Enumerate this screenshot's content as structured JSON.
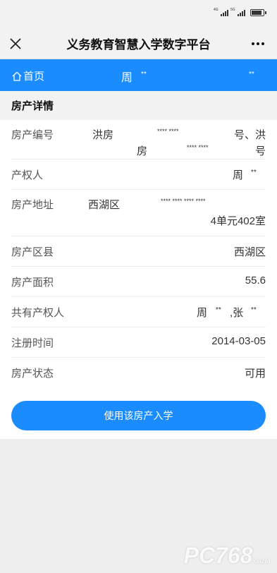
{
  "status_bar": {
    "signal1_tag": "4G",
    "signal2_tag": "5G"
  },
  "title_bar": {
    "title": "义务教育智慧入学数字平台"
  },
  "nav": {
    "home_label": "首页",
    "user_name": "周",
    "user_mask_1": "**",
    "user_mask_2": "**"
  },
  "section": {
    "title": "房产详情"
  },
  "details": {
    "code": {
      "label": "房产编号",
      "part1": "洪房",
      "mask1": "**** ****",
      "part2": "号、洪",
      "part3": "房",
      "mask2": "**** ****",
      "part4": "号"
    },
    "owner": {
      "label": "产权人",
      "name": "周",
      "mask": "**"
    },
    "address": {
      "label": "房产地址",
      "part1": "西湖区",
      "mask": "**** **** **** ****",
      "part2": "4单元402室"
    },
    "district": {
      "label": "房产区县",
      "value": "西湖区"
    },
    "area": {
      "label": "房产面积",
      "value": "55.6"
    },
    "co_owner": {
      "label": "共有产权人",
      "name1": "周",
      "mask1": "**",
      "name2": ",张",
      "mask2": "**"
    },
    "reg_date": {
      "label": "注册时间",
      "value": "2014-03-05"
    },
    "status": {
      "label": "房产状态",
      "value": "可用"
    }
  },
  "actions": {
    "enroll_label": "使用该房产入学"
  },
  "watermark": {
    "text": "PC768",
    "sub": "xiazai"
  },
  "colors": {
    "accent": "#1a8cfe"
  }
}
